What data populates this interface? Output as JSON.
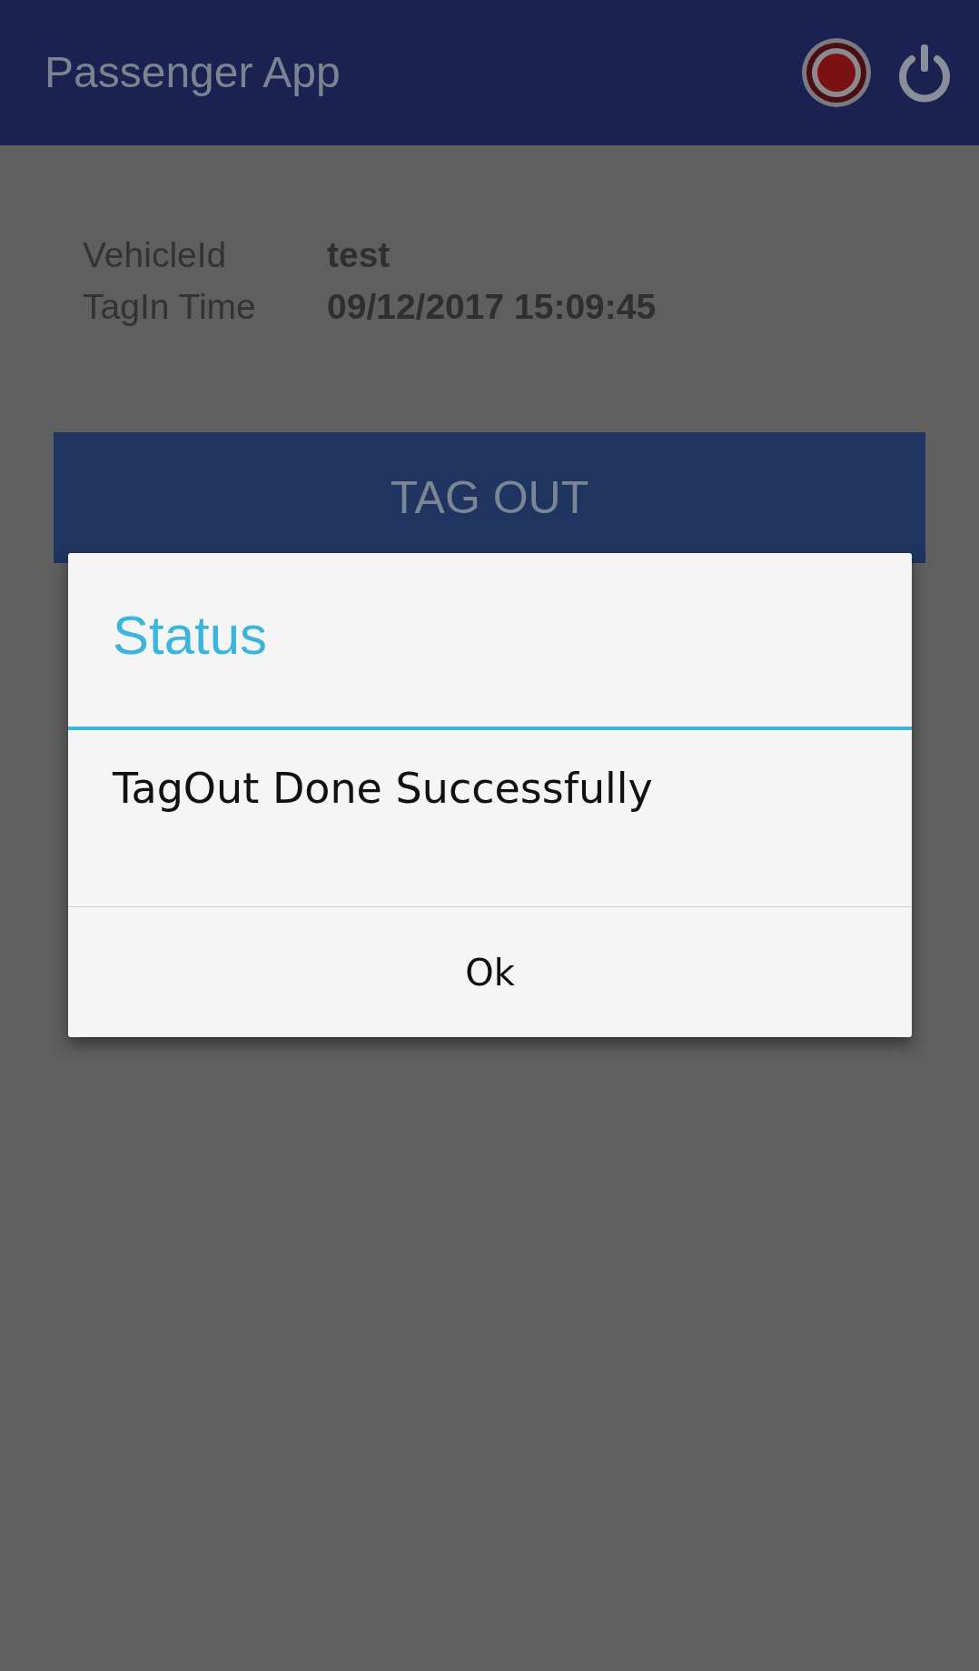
{
  "app_bar": {
    "title": "Passenger App"
  },
  "details": [
    {
      "label": "VehicleId",
      "value": "test"
    },
    {
      "label": "TagIn Time",
      "value": "09/12/2017 15:09:45"
    }
  ],
  "tag_out_button": {
    "label": "TAG OUT"
  },
  "dialog": {
    "title": "Status",
    "message": "TagOut Done Successfully",
    "button": "Ok"
  }
}
